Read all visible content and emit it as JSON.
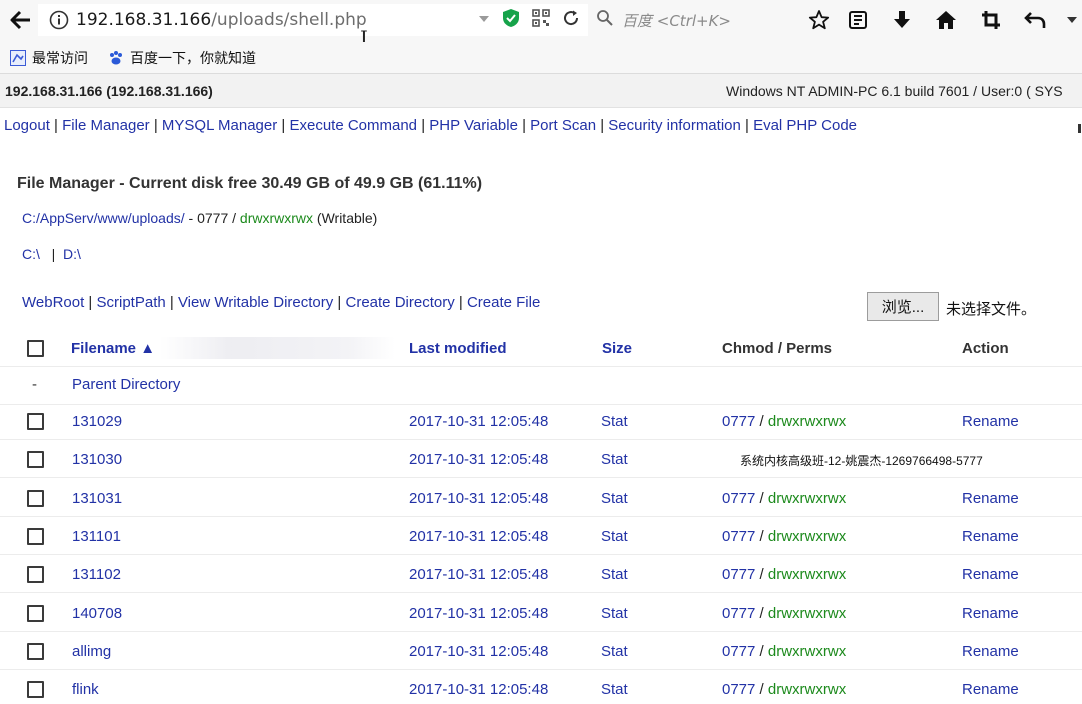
{
  "browser": {
    "url_host": "192.168.31.166",
    "url_path": "/uploads/shell.php",
    "search_placeholder": "百度 <Ctrl+K>",
    "bookmarks": [
      {
        "label": "最常访问"
      },
      {
        "label": "百度一下，你就知道"
      }
    ]
  },
  "page": {
    "server_host": "192.168.31.166 (192.168.31.166)",
    "server_info": "Windows NT ADMIN-PC 6.1 build 7601 / User:0 ( SYS",
    "menu": [
      {
        "label": "Logout"
      },
      {
        "label": "File Manager"
      },
      {
        "label": "MYSQL Manager"
      },
      {
        "label": "Execute Command"
      },
      {
        "label": "PHP Variable"
      },
      {
        "label": "Port Scan"
      },
      {
        "label": "Security information"
      },
      {
        "label": "Eval PHP Code"
      }
    ],
    "fm_title": "File Manager - Current disk free 30.49 GB of 49.9 GB (61.11%)",
    "current_path": "C:/AppServ/www/uploads/",
    "path_perm": " - 0777 / ",
    "path_perm_str": "drwxrwxrwx",
    "path_writable": " (Writable)",
    "drives": [
      "C:\\",
      "D:\\"
    ],
    "drive_sep": "|",
    "actions": [
      {
        "label": "WebRoot"
      },
      {
        "label": "ScriptPath"
      },
      {
        "label": "View Writable Directory"
      },
      {
        "label": "Create Directory"
      },
      {
        "label": "Create File"
      }
    ],
    "browse_label": "浏览...",
    "no_file_label": "未选择文件。",
    "table": {
      "headers": {
        "filename": "Filename ▲",
        "last_modified": "Last modified",
        "size": "Size",
        "chmod": "Chmod / Perms",
        "action": "Action"
      },
      "parent_dash": "-",
      "parent_label": "Parent Directory",
      "rows": [
        {
          "name": "131029",
          "modified": "2017-10-31 12:05:48",
          "size": "Stat",
          "chmod": "0777",
          "perms": "drwxrwxrwx",
          "action": "Rename"
        },
        {
          "name": "131030",
          "modified": "2017-10-31 12:05:48",
          "size": "Stat",
          "chmod": "",
          "perms": "",
          "action": ""
        },
        {
          "name": "131031",
          "modified": "2017-10-31 12:05:48",
          "size": "Stat",
          "chmod": "0777",
          "perms": "drwxrwxrwx",
          "action": "Rename"
        },
        {
          "name": "131101",
          "modified": "2017-10-31 12:05:48",
          "size": "Stat",
          "chmod": "0777",
          "perms": "drwxrwxrwx",
          "action": "Rename"
        },
        {
          "name": "131102",
          "modified": "2017-10-31 12:05:48",
          "size": "Stat",
          "chmod": "0777",
          "perms": "drwxrwxrwx",
          "action": "Rename"
        },
        {
          "name": "140708",
          "modified": "2017-10-31 12:05:48",
          "size": "Stat",
          "chmod": "0777",
          "perms": "drwxrwxrwx",
          "action": "Rename"
        },
        {
          "name": "allimg",
          "modified": "2017-10-31 12:05:48",
          "size": "Stat",
          "chmod": "0777",
          "perms": "drwxrwxrwx",
          "action": "Rename"
        },
        {
          "name": "flink",
          "modified": "2017-10-31 12:05:48",
          "size": "Stat",
          "chmod": "0777",
          "perms": "drwxrwxrwx",
          "action": "Rename"
        }
      ]
    },
    "overlay_text": "系统内核高级班-12-姚震杰-1269766498-5777"
  },
  "icons": {
    "back": "back-arrow-icon",
    "info": "info-icon",
    "dropdown": "dropdown-icon",
    "shield": "shield-check-icon",
    "qr": "qr-code-icon",
    "reload": "reload-icon",
    "search": "search-icon",
    "star": "star-bookmark-icon",
    "reading_list": "reading-list-icon",
    "download": "download-icon",
    "home": "home-icon",
    "crop": "screenshot-crop-icon",
    "undo": "undo-icon",
    "menu": "menu-chevron-icon"
  },
  "colors": {
    "link": "#2232a6",
    "perm_green": "#1c8a1c",
    "shield_green": "#16a34a"
  }
}
